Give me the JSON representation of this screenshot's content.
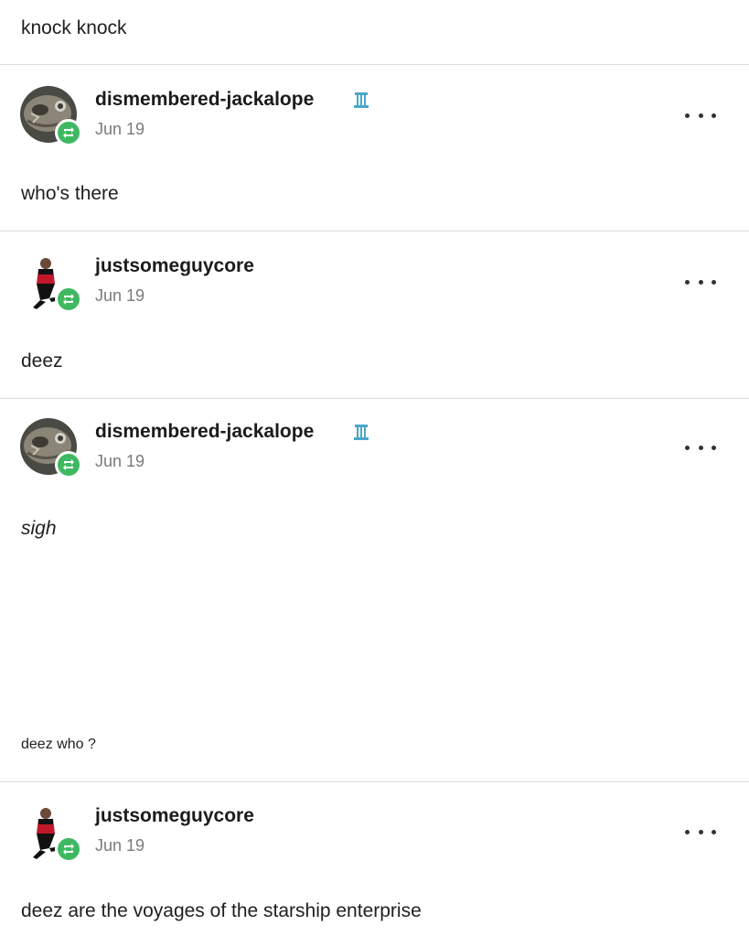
{
  "thread": {
    "original_text": "knock knock",
    "posts": [
      {
        "username": "dismembered-jackalope",
        "date": "Jun 19",
        "avatar_icon": "skull-avatar",
        "has_badge": true,
        "badge_icon": "blue-pillar-badge-icon",
        "reblog_icon": "reblog-icon",
        "more_icon": "more-options-icon",
        "body": [
          "who's there"
        ]
      },
      {
        "username": "justsomeguycore",
        "date": "Jun 19",
        "avatar_icon": "starfleet-officer-avatar",
        "has_badge": false,
        "reblog_icon": "reblog-icon",
        "more_icon": "more-options-icon",
        "body": [
          "deez"
        ]
      },
      {
        "username": "dismembered-jackalope",
        "date": "Jun 19",
        "avatar_icon": "skull-avatar",
        "has_badge": true,
        "badge_icon": "blue-pillar-badge-icon",
        "reblog_icon": "reblog-icon",
        "more_icon": "more-options-icon",
        "body": [
          "sigh",
          "deez who ?"
        ]
      },
      {
        "username": "justsomeguycore",
        "date": "Jun 19",
        "avatar_icon": "starfleet-officer-avatar",
        "has_badge": false,
        "reblog_icon": "reblog-icon",
        "more_icon": "more-options-icon",
        "body": [
          "deez are the voyages of the starship enterprise"
        ]
      }
    ]
  },
  "colors": {
    "reblog_green": "#3fb861",
    "badge_blue": "#4aa6c9",
    "divider": "#dcdcdc",
    "date_gray": "#7a7a7a"
  }
}
